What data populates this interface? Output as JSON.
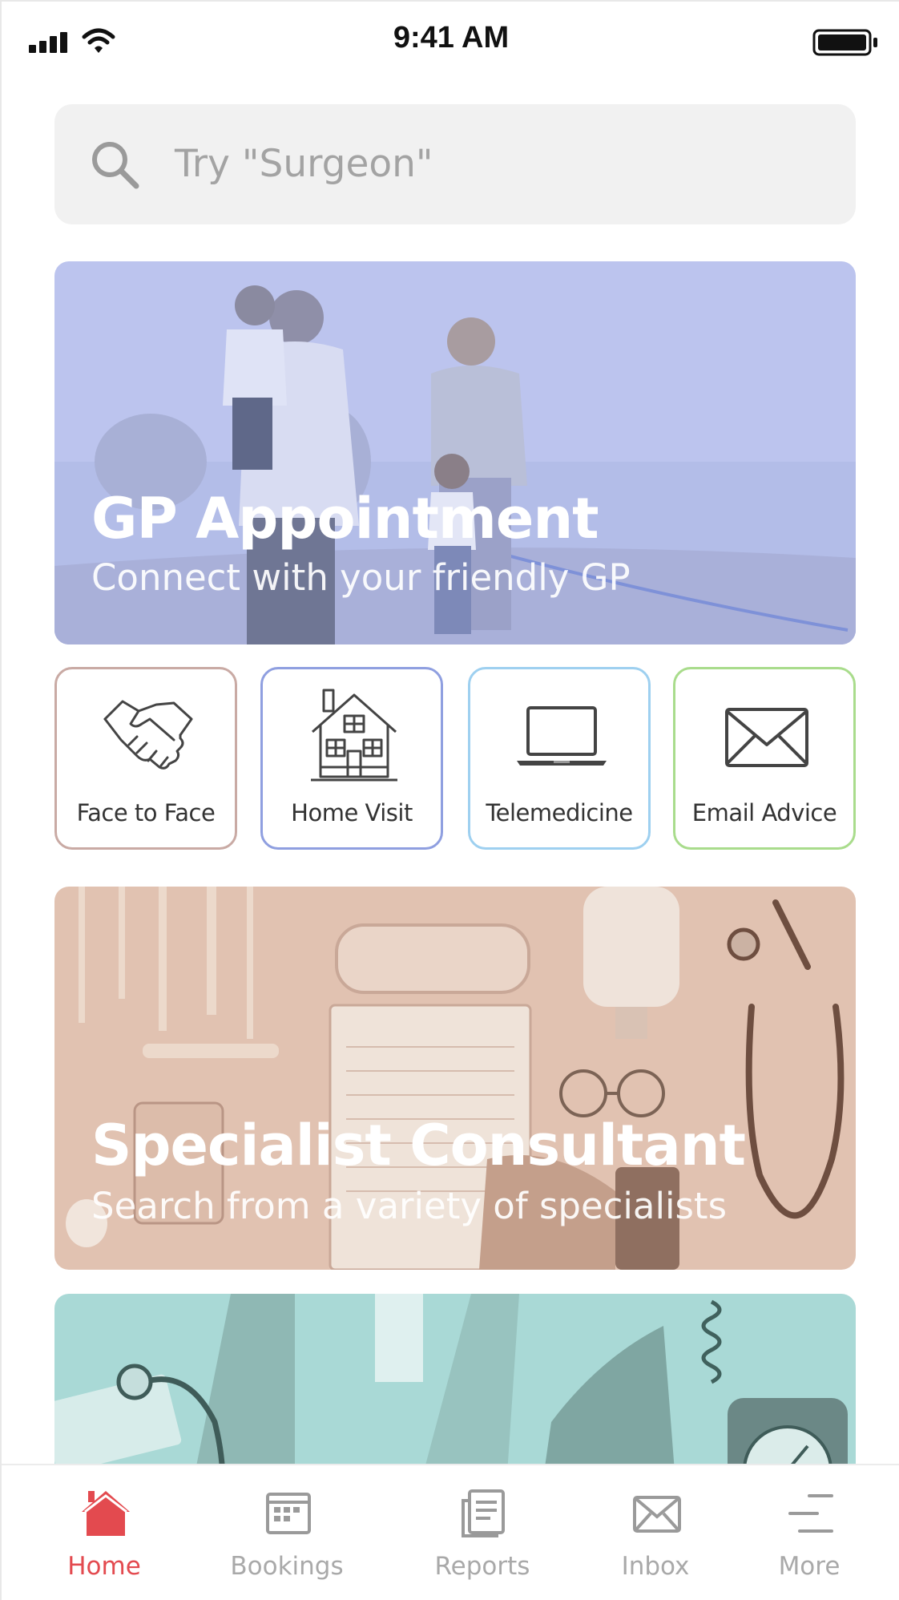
{
  "status_bar": {
    "time": "9:41 AM"
  },
  "search": {
    "placeholder": "Try \"Surgeon\""
  },
  "banners": [
    {
      "title": "GP Appointment",
      "subtitle": "Connect with your friendly GP"
    },
    {
      "title": "Specialist Consultant",
      "subtitle": "Search from a variety of specialists"
    }
  ],
  "services": [
    {
      "label": "Face to Face",
      "icon": "handshake-icon"
    },
    {
      "label": "Home Visit",
      "icon": "house-icon"
    },
    {
      "label": "Telemedicine",
      "icon": "laptop-icon"
    },
    {
      "label": "Email Advice",
      "icon": "envelope-icon"
    }
  ],
  "tabs": [
    {
      "label": "Home",
      "icon": "home-icon",
      "active": true
    },
    {
      "label": "Bookings",
      "icon": "calendar-icon",
      "active": false
    },
    {
      "label": "Reports",
      "icon": "report-icon",
      "active": false
    },
    {
      "label": "Inbox",
      "icon": "inbox-icon",
      "active": false
    },
    {
      "label": "More",
      "icon": "menu-icon",
      "active": false
    }
  ],
  "colors": {
    "accent": "#e34a4f",
    "gp_overlay": "#b7c0ec",
    "specialist_overlay": "#e0bfae",
    "third_overlay": "#a8d8d5"
  }
}
